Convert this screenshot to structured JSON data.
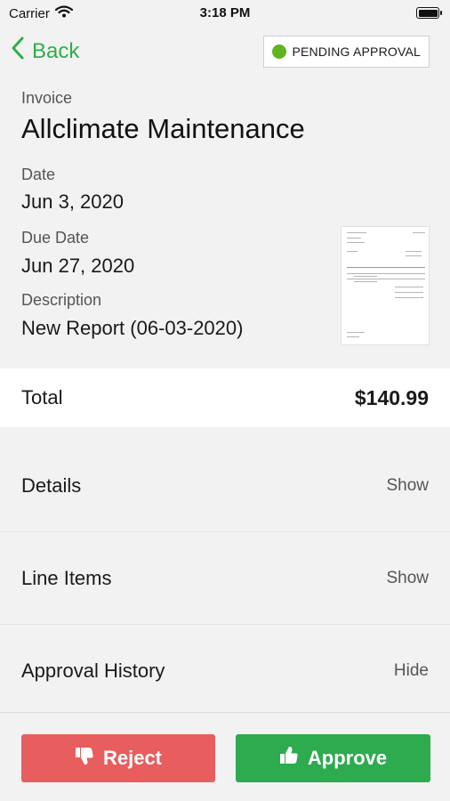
{
  "status_bar": {
    "carrier": "Carrier",
    "time": "3:18 PM"
  },
  "nav": {
    "back_label": "Back",
    "status_badge": "PENDING APPROVAL"
  },
  "invoice": {
    "type_label": "Invoice",
    "vendor": "Allclimate Maintenance",
    "date_label": "Date",
    "date": "Jun 3, 2020",
    "due_date_label": "Due Date",
    "due_date": "Jun 27, 2020",
    "description_label": "Description",
    "description": "New Report (06-03-2020)"
  },
  "total": {
    "label": "Total",
    "amount": "$140.99"
  },
  "sections": [
    {
      "title": "Details",
      "action": "Show"
    },
    {
      "title": "Line Items",
      "action": "Show"
    },
    {
      "title": "Approval History",
      "action": "Hide"
    }
  ],
  "actions": {
    "reject_label": "Reject",
    "approve_label": "Approve"
  },
  "colors": {
    "accent": "#2fae4a",
    "approve": "#2eaa4f",
    "reject": "#e85d5d",
    "pending_dot": "#5fb41f"
  },
  "icons": [
    "wifi-icon",
    "battery-icon",
    "chevron-left-icon",
    "status-dot-icon",
    "document-thumbnail",
    "thumbs-down-icon",
    "thumbs-up-icon"
  ]
}
